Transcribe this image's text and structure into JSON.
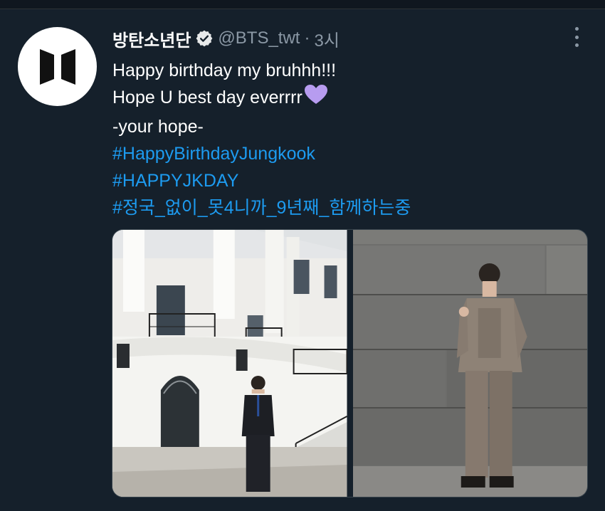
{
  "tweet": {
    "author_name": "방탄소년단",
    "handle": "@BTS_twt",
    "separator": "·",
    "time": "3시",
    "lines": [
      "Happy birthday my bruhhh!!!",
      "Hope U best day everrrr",
      "-your hope-"
    ],
    "hashtags": [
      "#HappyBirthdayJungkook",
      "#HAPPYJKDAY",
      "#정국_없이_못4니까_9년째_함께하는중"
    ],
    "heart_emoji_color": "#b79cf0"
  },
  "media": {
    "photos": [
      {
        "subject": "white-house-portico-photo"
      },
      {
        "subject": "grey-wall-portrait-photo"
      }
    ]
  },
  "colors": {
    "background": "#15202b",
    "link": "#1d9bf0",
    "muted": "#8b98a5",
    "verified": "#e7e9ea"
  }
}
